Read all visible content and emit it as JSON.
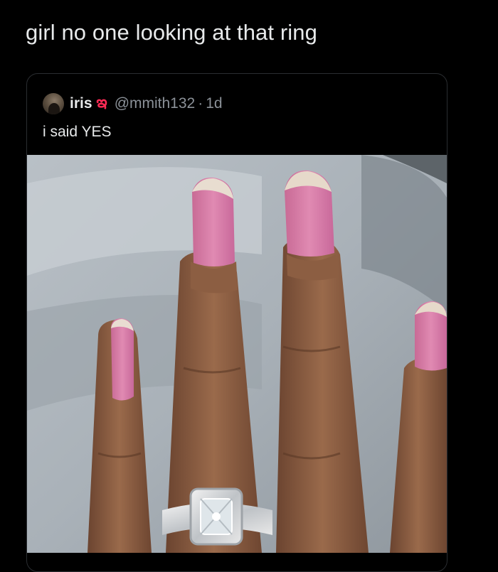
{
  "post": {
    "text": "girl no one looking at that ring"
  },
  "quote": {
    "display_name": "iris",
    "name_emoji": "ఇ",
    "handle": "@mmith132",
    "separator": "·",
    "time": "1d",
    "text": "i said YES"
  },
  "icons": {
    "avatar": "user-avatar-photo"
  },
  "colors": {
    "background": "#000000",
    "primary_text": "#e7e9ea",
    "secondary_text": "#8b9198",
    "card_border": "#2a2d31",
    "nail_polish": "#d97aa4",
    "skin": "#8a5a3c"
  }
}
